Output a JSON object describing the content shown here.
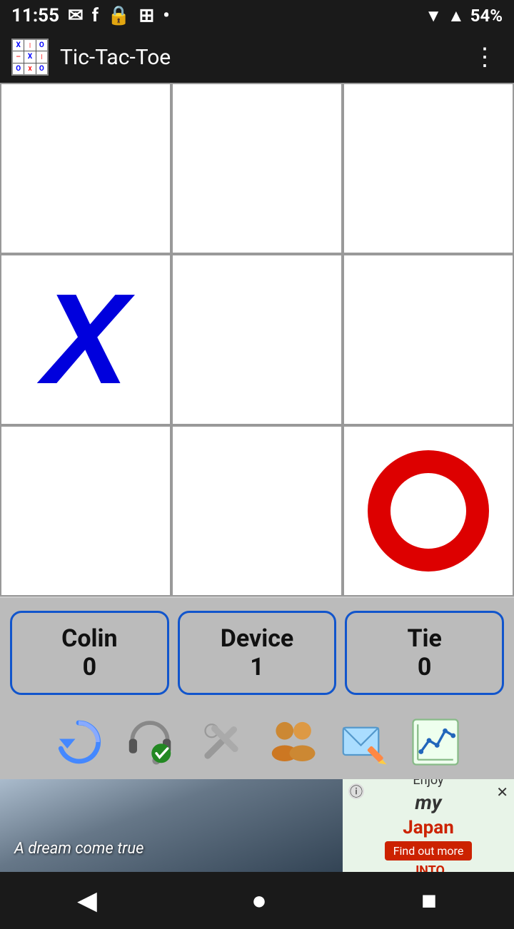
{
  "statusBar": {
    "time": "11:55",
    "battery": "54%"
  },
  "appBar": {
    "title": "Tic-Tac-Toe",
    "moreLabel": "⋮"
  },
  "board": {
    "cells": [
      {
        "id": "0",
        "value": ""
      },
      {
        "id": "1",
        "value": ""
      },
      {
        "id": "2",
        "value": ""
      },
      {
        "id": "3",
        "value": "X"
      },
      {
        "id": "4",
        "value": ""
      },
      {
        "id": "5",
        "value": ""
      },
      {
        "id": "6",
        "value": ""
      },
      {
        "id": "7",
        "value": ""
      },
      {
        "id": "8",
        "value": "O"
      }
    ]
  },
  "scores": [
    {
      "label": "Colin",
      "value": "0"
    },
    {
      "label": "Device",
      "value": "1"
    },
    {
      "label": "Tie",
      "value": "0"
    }
  ],
  "toolbar": {
    "icons": [
      {
        "name": "refresh",
        "symbol": "🔄"
      },
      {
        "name": "audio",
        "symbol": "🎧"
      },
      {
        "name": "settings",
        "symbol": "🔧"
      },
      {
        "name": "users",
        "symbol": "👥"
      },
      {
        "name": "mail",
        "symbol": "📧"
      },
      {
        "name": "chart",
        "symbol": "📊"
      }
    ]
  },
  "ad": {
    "leftText": "A dream come true",
    "enjoyText": "Enjoy",
    "myText": "my",
    "japanText": "Japan",
    "findText": "Find out more",
    "orgText": "JNTO"
  },
  "nav": {
    "back": "◀",
    "home": "●",
    "recent": "■"
  }
}
